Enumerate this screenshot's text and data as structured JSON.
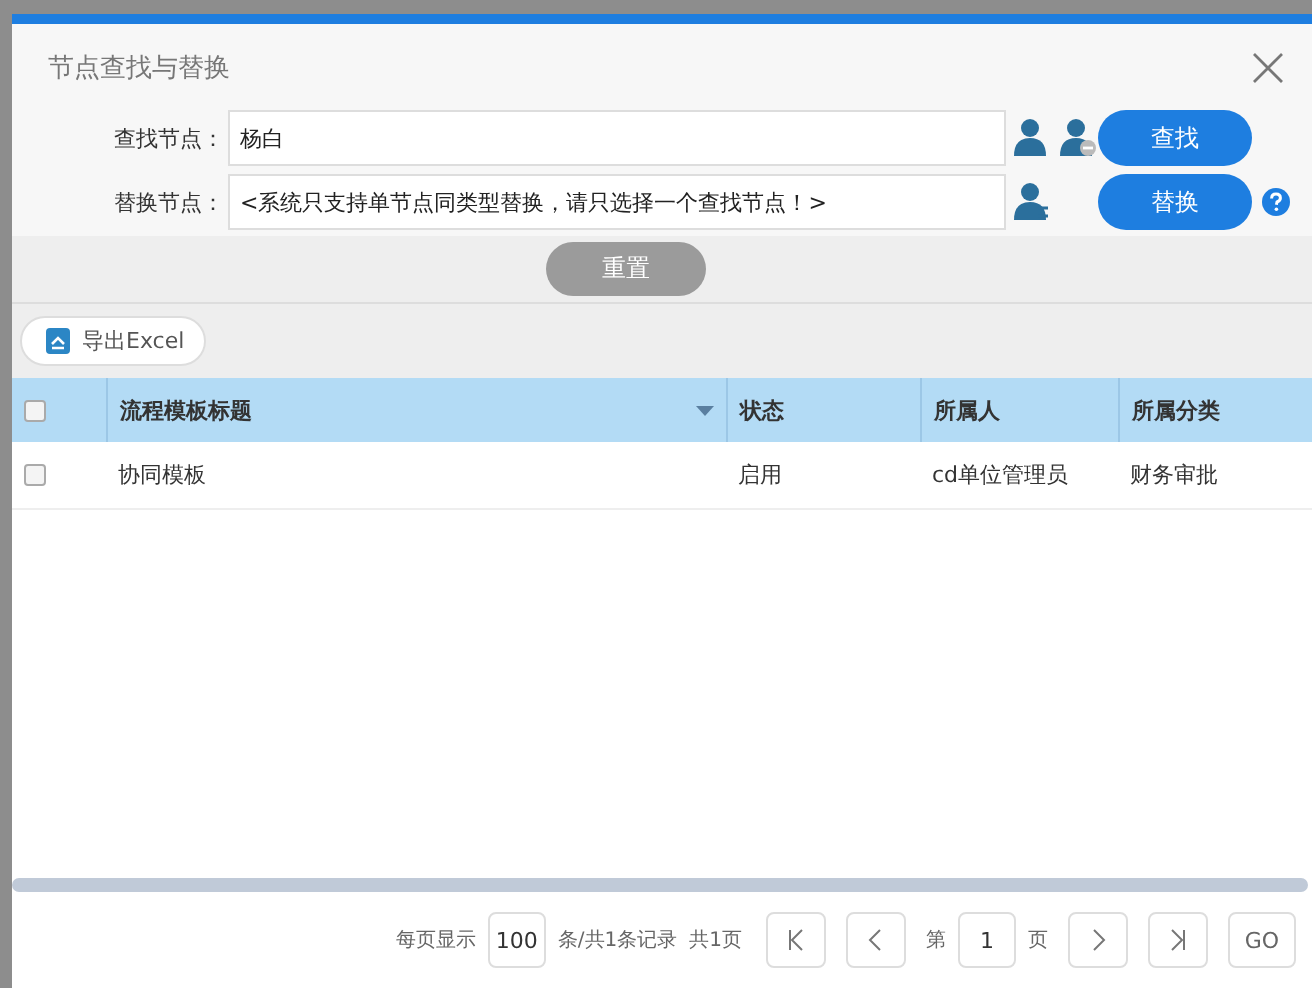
{
  "dialog": {
    "title": "节点查找与替换"
  },
  "form": {
    "find": {
      "label": "查找节点：",
      "value": "杨白",
      "button": "查找"
    },
    "replace": {
      "label": "替换节点：",
      "value": "<系统只支持单节点同类型替换，请只选择一个查找节点！>",
      "button": "替换"
    },
    "reset_button": "重置"
  },
  "toolbar": {
    "export_button": "导出Excel"
  },
  "table": {
    "columns": [
      {
        "label": "流程模板标题",
        "sortable": true
      },
      {
        "label": "状态",
        "sortable": false
      },
      {
        "label": "所属人",
        "sortable": false
      },
      {
        "label": "所属分类",
        "sortable": false
      }
    ],
    "all_checked": false,
    "rows": [
      {
        "checked": false,
        "cells": [
          "协同模板",
          "启用",
          "cd单位管理员",
          "财务审批"
        ]
      }
    ]
  },
  "pager": {
    "per_page_label": "每页显示",
    "per_page": "100",
    "summary": "条/共1条记录",
    "pages": "共1页",
    "page_prefix": "第",
    "page": "1",
    "page_suffix": "页",
    "go": "GO"
  }
}
